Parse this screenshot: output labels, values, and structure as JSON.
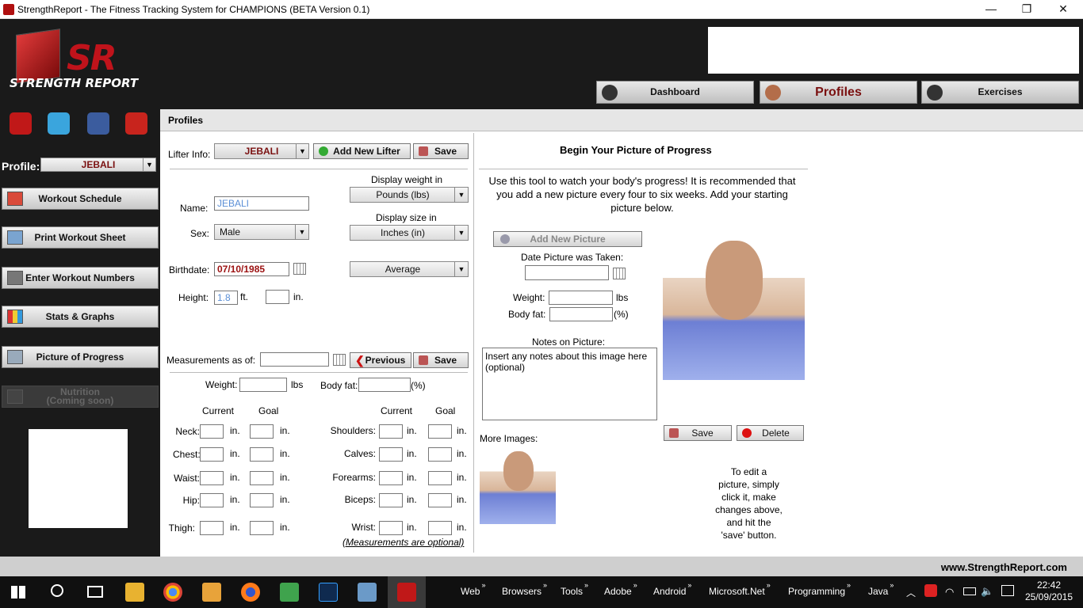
{
  "window": {
    "title": "StrengthReport - The Fitness Tracking System for CHAMPIONS (BETA Version 0.1)",
    "minimize": "—",
    "maximize": "❐",
    "close": "✕"
  },
  "logo": {
    "mark": "SR",
    "text": "STRENGTH REPORT"
  },
  "nav": {
    "dashboard": "Dashboard",
    "profiles": "Profiles",
    "exercises": "Exercises"
  },
  "sidebar": {
    "profile_label": "Profile:",
    "profile_value": "JEBALI",
    "items": [
      {
        "label": "Workout Schedule"
      },
      {
        "label": "Print Workout Sheet"
      },
      {
        "label": "Enter Workout Numbers"
      },
      {
        "label": "Stats & Graphs"
      },
      {
        "label": "Picture of Progress"
      }
    ],
    "nutrition_line1": "Nutrition",
    "nutrition_line2": "(Coming soon)"
  },
  "content": {
    "header": "Profiles",
    "lifter_info_label": "Lifter Info:",
    "lifter_value": "JEBALI",
    "add_new_lifter": "Add New Lifter",
    "save": "Save",
    "display_weight_label": "Display weight in",
    "display_weight_value": "Pounds (lbs)",
    "display_size_label": "Display size in",
    "display_size_value": "Inches (in)",
    "name_label": "Name:",
    "name_value": "JEBALI",
    "sex_label": "Sex:",
    "sex_value": "Male",
    "birthdate_label": "Birthdate:",
    "birthdate_value": "07/10/1985",
    "build_value": "Average",
    "height_label": "Height:",
    "height_ft_value": "1.8",
    "ft": "ft.",
    "in": "in.",
    "measurements_label": "Measurements as of:",
    "previous": "Previous",
    "weight_label": "Weight:",
    "lbs": "lbs",
    "bodyfat_label": "Body fat:",
    "pct": "(%)",
    "current": "Current",
    "goal": "Goal",
    "left_rows": [
      "Neck:",
      "Chest:",
      "Waist:",
      "Hip:",
      "Thigh:"
    ],
    "right_rows": [
      "Shoulders:",
      "Calves:",
      "Forearms:",
      "Biceps:",
      "Wrist:"
    ],
    "optional_note": "(Measurements are optional)"
  },
  "progress": {
    "title": "Begin Your Picture of Progress",
    "intro": "Use this tool to watch your body's progress! It is recommended that you add a new picture every four to six weeks. Add your starting picture below.",
    "add_new_picture": "Add New Picture",
    "date_label": "Date Picture was Taken:",
    "weight_label": "Weight:",
    "lbs": "lbs",
    "bodyfat_label": "Body fat:",
    "pct": "(%)",
    "notes_label": "Notes on Picture:",
    "notes_value": "Insert any notes about this image here (optional)",
    "more_images": "More Images:",
    "save": "Save",
    "delete": "Delete",
    "edit_hint": "To edit a picture, simply click it, make changes above, and hit the 'save' button."
  },
  "footer": {
    "url": "www.StrengthReport.com"
  },
  "taskbar": {
    "groups": [
      "Web",
      "Browsers",
      "Tools",
      "Adobe",
      "Android",
      "Microsoft.Net",
      "Programming",
      "Java"
    ],
    "time": "22:42",
    "date": "25/09/2015"
  },
  "colors": {
    "accent": "#7a1010",
    "header_bg": "#1a1a1a",
    "brand_red": "#c0131b"
  }
}
